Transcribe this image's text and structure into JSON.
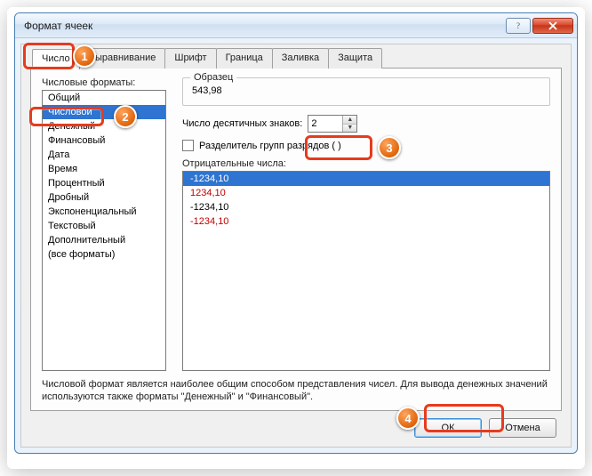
{
  "window": {
    "title": "Формат ячеек"
  },
  "tabs": [
    "Число",
    "Выравнивание",
    "Шрифт",
    "Граница",
    "Заливка",
    "Защита"
  ],
  "activeTab": 0,
  "left": {
    "label": "Числовые форматы:",
    "items": [
      "Общий",
      "Числовой",
      "Денежный",
      "Финансовый",
      "Дата",
      "Время",
      "Процентный",
      "Дробный",
      "Экспоненциальный",
      "Текстовый",
      "Дополнительный",
      "(все форматы)"
    ],
    "selectedIndex": 1
  },
  "sample": {
    "legend": "Образец",
    "value": "543,98"
  },
  "decimal": {
    "label": "Число десятичных знаков:",
    "value": "2"
  },
  "thousands": {
    "label": "Разделитель групп разрядов ( )",
    "checked": false
  },
  "negative": {
    "label": "Отрицательные числа:",
    "items": [
      {
        "text": "-1234,10",
        "selected": true,
        "red": false
      },
      {
        "text": "1234,10",
        "selected": false,
        "red": true
      },
      {
        "text": "-1234,10",
        "selected": false,
        "red": false
      },
      {
        "text": "-1234,10",
        "selected": false,
        "red": true
      }
    ]
  },
  "description": "Числовой формат является наиболее общим способом представления чисел. Для вывода денежных значений используются также форматы \"Денежный\" и \"Финансовый\".",
  "buttons": {
    "ok": "ОК",
    "cancel": "Отмена"
  },
  "annotations": [
    "1",
    "2",
    "3",
    "4"
  ]
}
